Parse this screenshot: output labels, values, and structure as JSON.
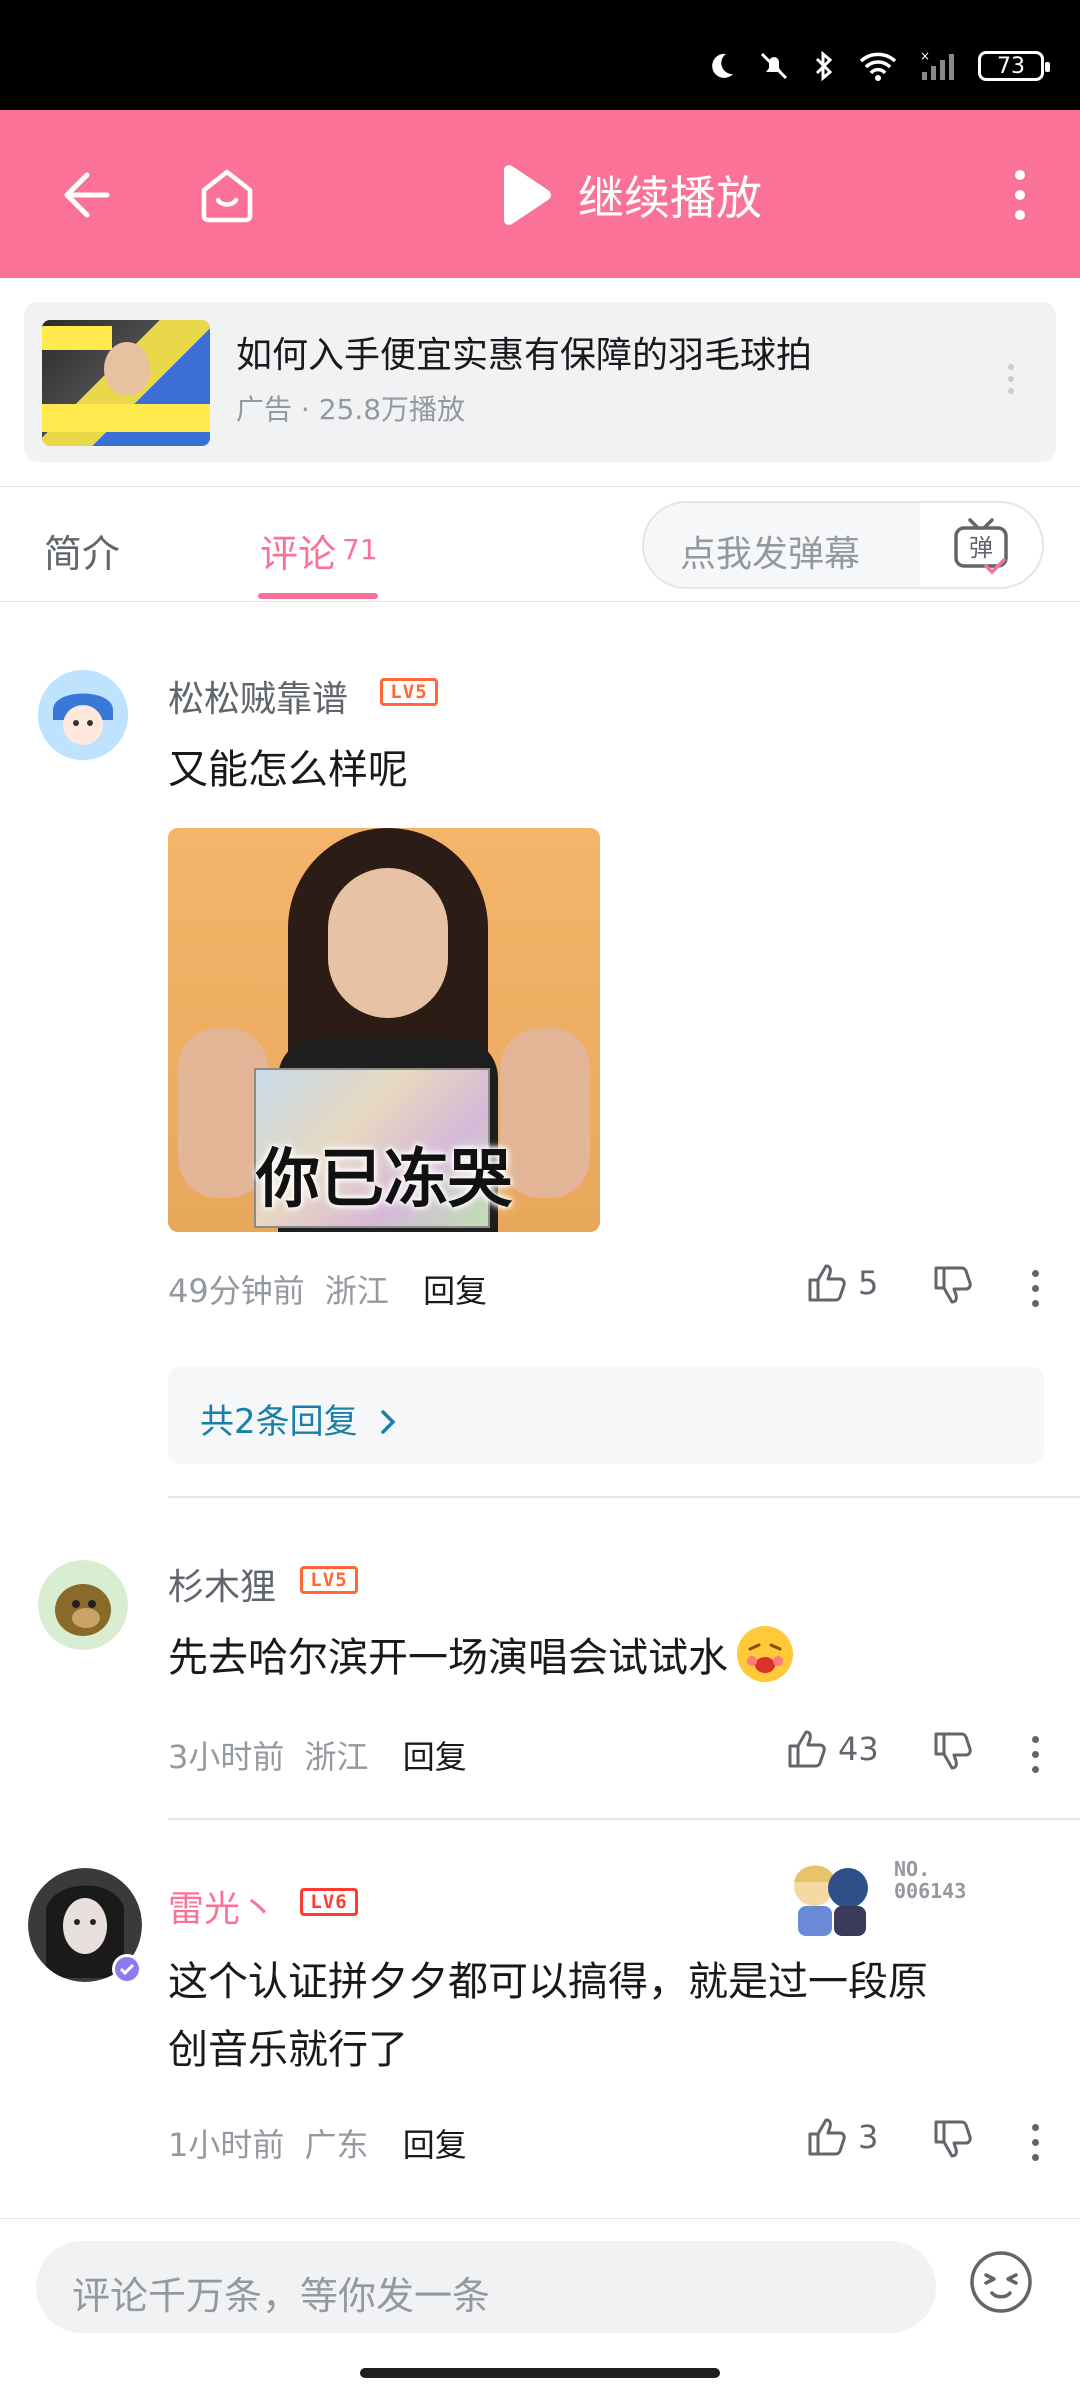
{
  "status_bar": {
    "battery": "73"
  },
  "header": {
    "play_label": "继续播放"
  },
  "ad": {
    "title": "如何入手便宜实惠有保障的羽毛球拍",
    "meta": "广告 · 25.8万播放"
  },
  "tabs": {
    "intro": "简介",
    "comments": "评论",
    "comment_count": "71"
  },
  "danmaku": {
    "placeholder": "点我发弹幕",
    "button_glyph": "弹"
  },
  "comments": [
    {
      "username": "松松贼靠谱",
      "level": "LV5",
      "text": "又能怎么样呢",
      "image_caption": "你已冻哭",
      "time": "49分钟前",
      "location": "浙江",
      "reply": "回复",
      "likes": "5",
      "sub_replies": "共2条回复"
    },
    {
      "username": "杉木狸",
      "level": "LV5",
      "text": "先去哈尔滨开一场演唱会试试水",
      "time": "3小时前",
      "location": "浙江",
      "reply": "回复",
      "likes": "43"
    },
    {
      "username": "雷光丶",
      "level": "LV6",
      "text_line1": "这个认证拼夕夕都可以搞得，就是过一段原",
      "text_line2": "创音乐就行了",
      "time": "1小时前",
      "location": "广东",
      "reply": "回复",
      "likes": "3",
      "decoration_id": "NO.\n006143"
    }
  ],
  "composer": {
    "placeholder": "评论千万条，等你发一条"
  },
  "colors": {
    "brand_pink": "#fb7299",
    "link_blue": "#1a7fa8"
  }
}
